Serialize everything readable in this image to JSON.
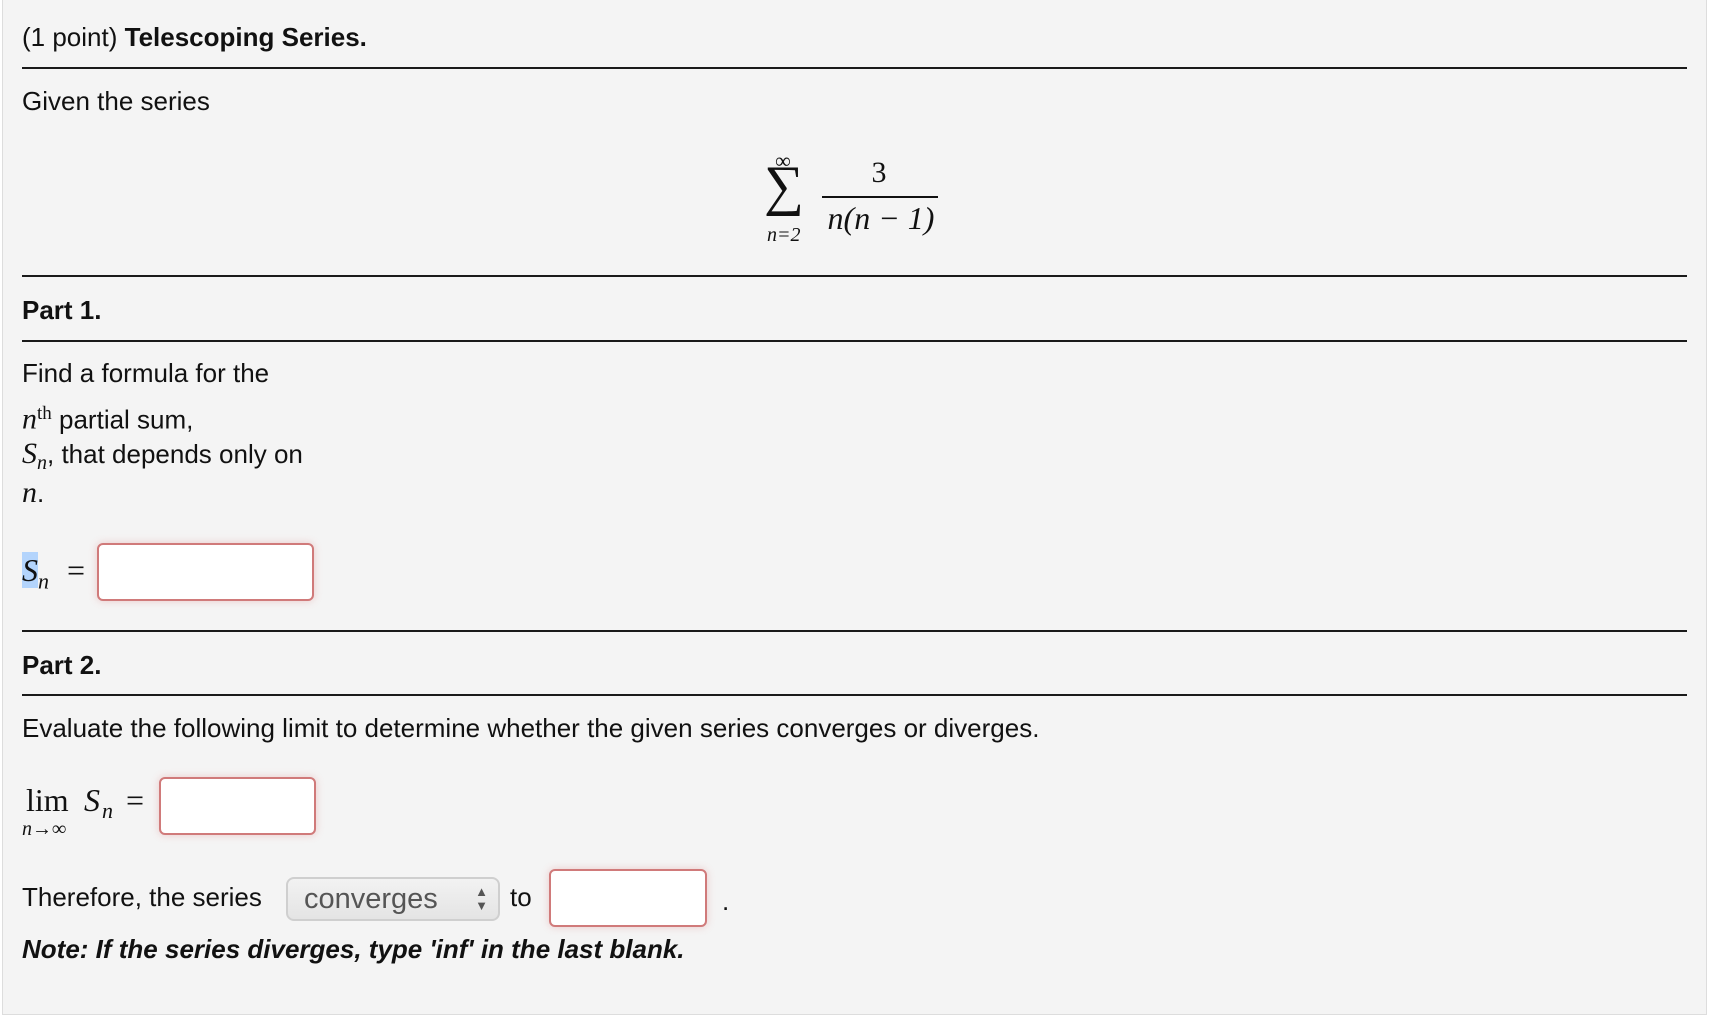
{
  "header": {
    "points": "(1 point)",
    "title": "Telescoping Series."
  },
  "intro": "Given the series",
  "series": {
    "upper": "∞",
    "lower": "n=2",
    "numerator": "3",
    "denominator": "n(n − 1)"
  },
  "part1": {
    "heading": "Part 1.",
    "lines": [
      "Find a formula for the",
      "partial sum,",
      ", that depends only on",
      "."
    ],
    "n": "n",
    "th": "th",
    "S": "S",
    "sub": "n",
    "equals": "=",
    "answer_value": ""
  },
  "part2": {
    "heading": "Part 2.",
    "instruction": "Evaluate the following limit to determine whether the given series converges or diverges.",
    "lim": "lim",
    "lim_sub": "n→∞",
    "S": "S",
    "sub": "n",
    "equals": "=",
    "limit_value": "",
    "therefore": "Therefore, the series",
    "select_value": "converges",
    "to": "to",
    "sum_value": "",
    "period": ".",
    "note": "Note: If the series diverges, type 'inf' in the last blank."
  },
  "colors": {
    "input_border": "#d07a7a",
    "background": "#f4f4f4",
    "highlight": "#b3d4fc"
  }
}
